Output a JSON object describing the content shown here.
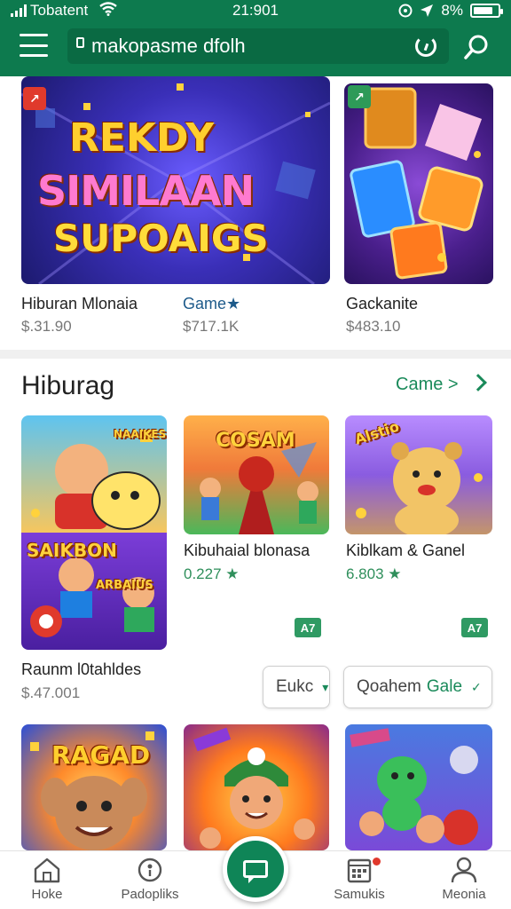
{
  "status_bar": {
    "carrier": "Tobatent",
    "time": "21:901",
    "battery": "8%"
  },
  "browser": {
    "url": "makopasme dfolh"
  },
  "featured": [
    {
      "title": "Hiburan Mlonaia",
      "price": "$.31.90",
      "art_lines": [
        "REKDY",
        "SIMILAAN",
        "SUPOAIGS"
      ]
    },
    {
      "title": "Game★",
      "price": "$717.1K"
    },
    {
      "title": "Gackanite",
      "price": "$483.10"
    }
  ],
  "section": {
    "title": "Hiburag",
    "more_label": "Came >"
  },
  "grid_row1": [
    {
      "title": "Raunm l0tahldes",
      "price": "$.47.001",
      "art_top": "SAIKBON",
      "art_bottom": "ARBAIUS",
      "art_corner": "NAAIKES"
    },
    {
      "title": "Kibuhaial blonasa",
      "rating": "0.227 ★",
      "tag": "A7",
      "art_label": "COSAM"
    },
    {
      "title": "Kiblkam & Ganel",
      "rating": "6.803 ★",
      "tag": "A7",
      "art_label": "Alstio"
    }
  ],
  "filters": [
    {
      "label": "Eukc",
      "caret": "▾"
    },
    {
      "label": "Qoahem",
      "accent": "Gale",
      "caret": "✓"
    }
  ],
  "grid_row2": [
    {
      "art_label": "RAGAD"
    },
    {
      "art_label": ""
    },
    {
      "art_label": ""
    }
  ],
  "bottom_nav": [
    {
      "label": "Hoke",
      "icon": "home-icon"
    },
    {
      "label": "Padopliks",
      "icon": "compass-icon"
    },
    {
      "label": "Samukis",
      "icon": "calendar-icon"
    },
    {
      "label": "Meonia",
      "icon": "person-icon"
    }
  ],
  "colors": {
    "brand": "#0d7a4e",
    "accent": "#1a8a5a",
    "rating": "#2f8f5b"
  }
}
